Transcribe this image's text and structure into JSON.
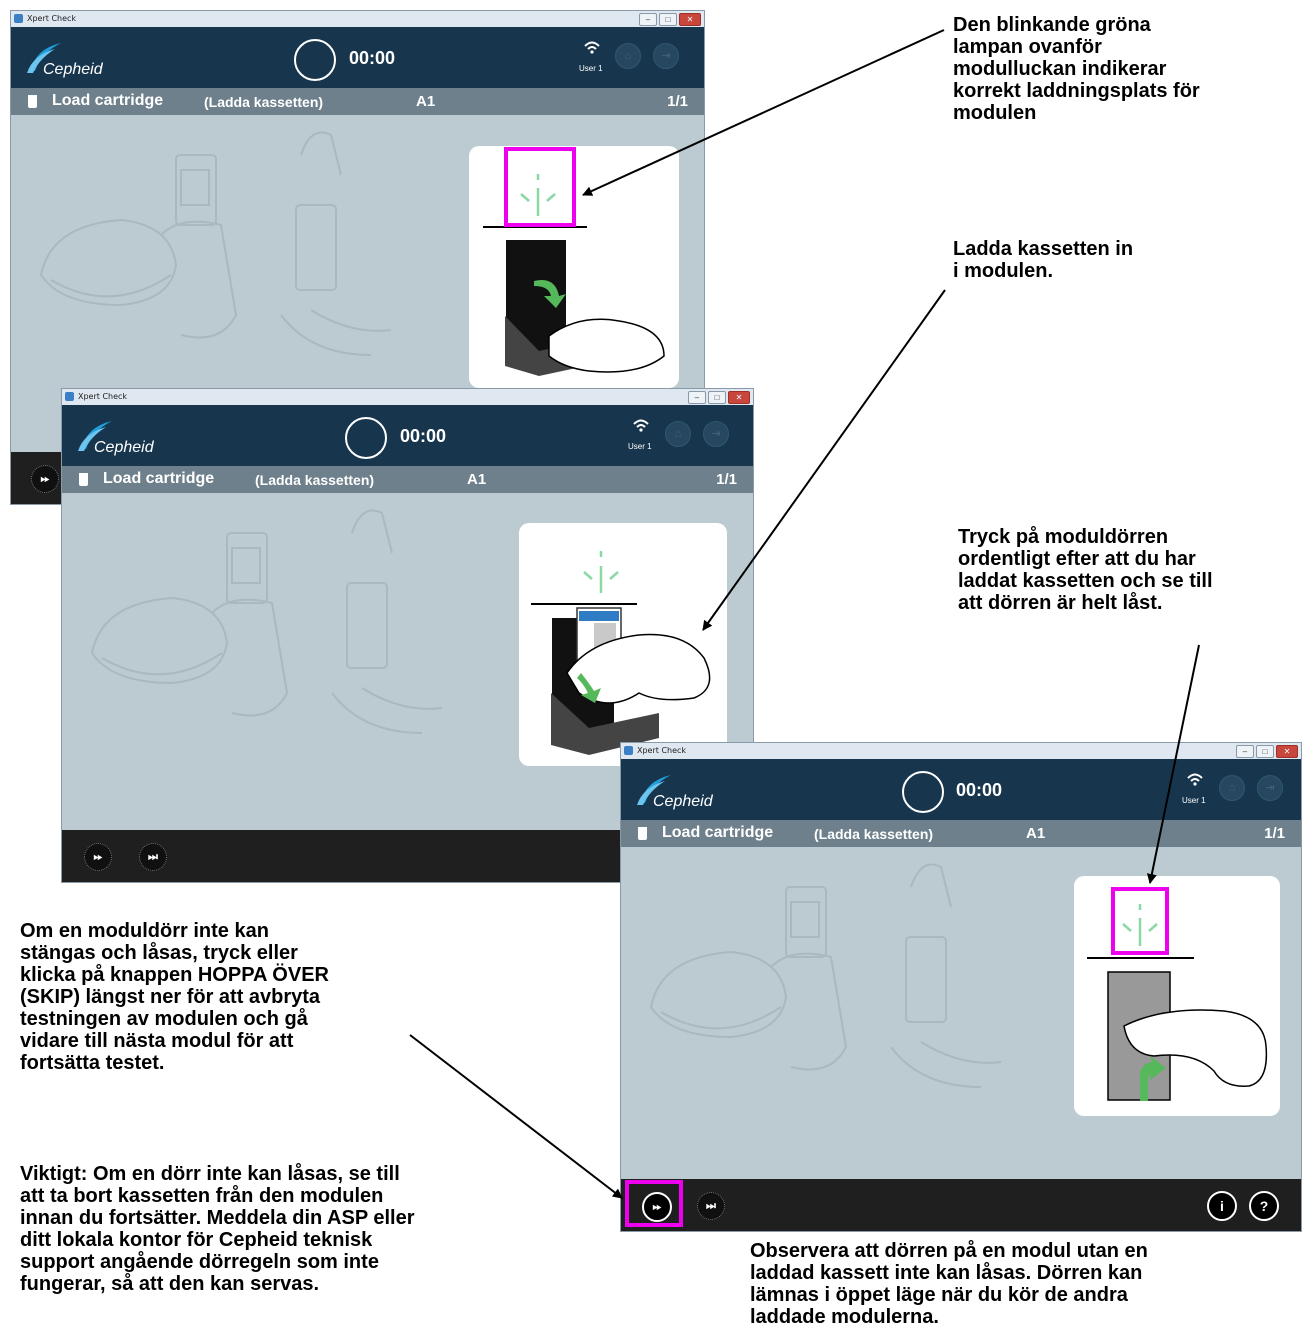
{
  "screens": [
    {
      "title_bar": "Xpert Check",
      "timer": "00:00",
      "user": "User 1",
      "logo": "Cepheid",
      "step_title": "Load cartridge",
      "step_subtitle": "(Ladda kassetten)",
      "module": "A1",
      "page": "1/1"
    },
    {
      "title_bar": "Xpert Check",
      "timer": "00:00",
      "user": "User 1",
      "logo": "Cepheid",
      "step_title": "Load cartridge",
      "step_subtitle": "(Ladda kassetten)",
      "module": "A1",
      "page": "1/1"
    },
    {
      "title_bar": "Xpert Check",
      "timer": "00:00",
      "user": "User 1",
      "logo": "Cepheid",
      "step_title": "Load cartridge",
      "step_subtitle": "(Ladda kassetten)",
      "module": "A1",
      "page": "1/1",
      "info_button": "i",
      "help_button": "?"
    }
  ],
  "annotations": {
    "green_light": "Den blinkande gröna\nlampan ovanför\nmodulluckan indikerar\nkorrekt laddningsplats för\nmodulen",
    "load": "Ladda kassetten in\ni modulen.",
    "press_door": "Tryck på moduldörren\nordentligt efter att du har\nladdat kassetten och se till\natt dörren är helt låst.",
    "skip": "Om en moduldörr inte kan\nstängas och låsas, tryck eller\nklicka på knappen HOPPA ÖVER\n(SKIP) längst ner för att avbryta\ntestningen av modulen och gå\nvidare till nästa modul för att\nfortsätta testet.",
    "important": "Viktigt: Om en dörr inte kan låsas, se till\natt ta bort kassetten från den modulen\ninnan du fortsätter. Meddela din ASP eller\nditt lokala kontor för Cepheid teknisk\nsupport angående dörregeln som inte\nfungerar, så att den kan servas.",
    "observe": "Observera att dörren på en modul utan en\nladdad kassett inte kan låsas. Dörren kan\nlämnas i öppet läge när du kör de andra\nladdade modulerna."
  },
  "colors": {
    "header": "#17364e",
    "stepbar": "#6e808c",
    "content": "#bccbd1",
    "footer": "#1f1f1f",
    "highlight": "#ee00ee",
    "light": "#7fd49a",
    "arrow": "#4cb34f"
  },
  "icons": {
    "skip": "fast-forward-icon",
    "skip_all": "skip-to-end-icon",
    "wifi": "wifi-icon",
    "home": "home-icon",
    "exit": "exit-icon"
  }
}
